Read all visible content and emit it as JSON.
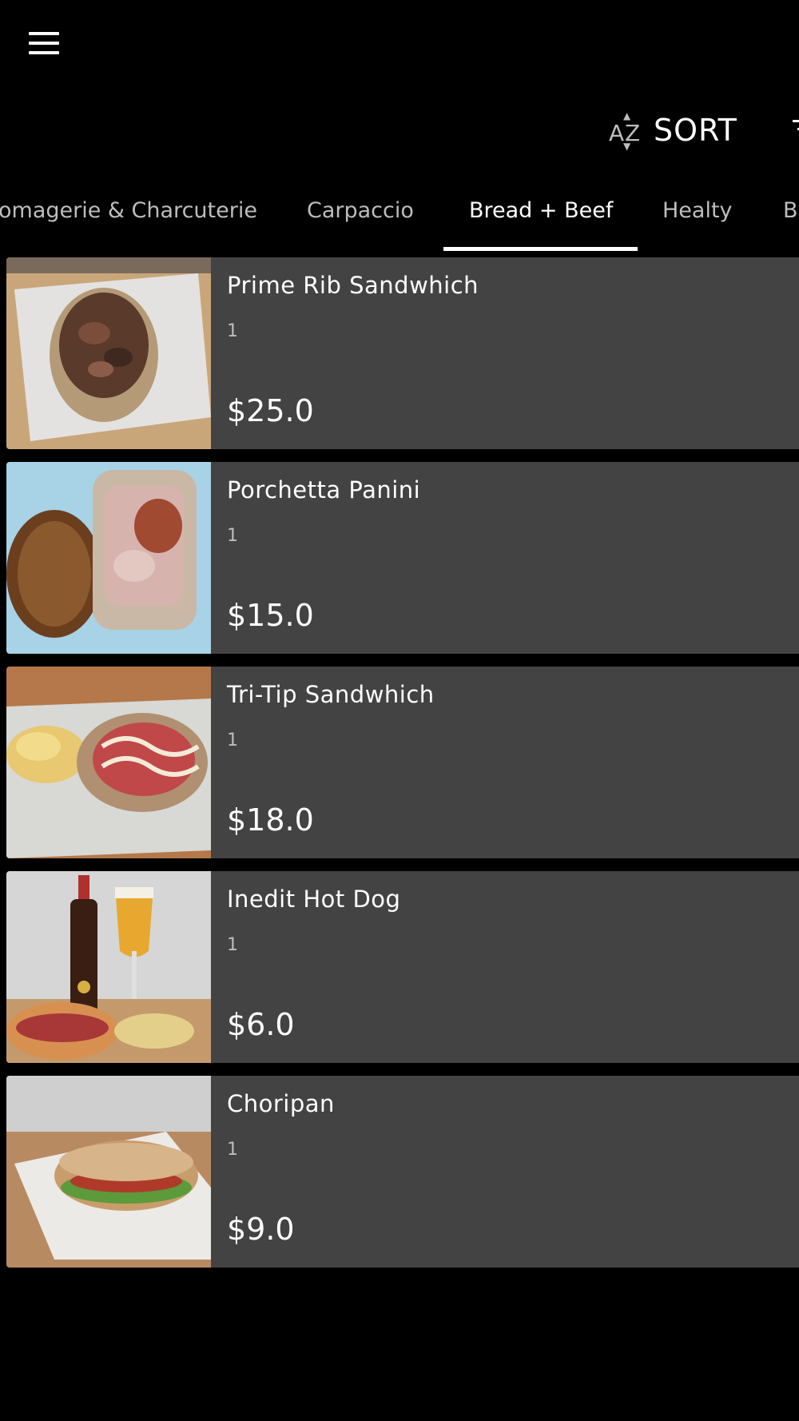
{
  "header": {
    "menu_icon": "hamburger-menu-icon",
    "sort_label": "SORT",
    "sort_icon": "az-sort-icon",
    "sort_icon_text": "AZ",
    "filter_icon": "filter-lines-icon"
  },
  "tabs": [
    {
      "label": "omagerie & Charcuterie",
      "active": false
    },
    {
      "label": "Carpaccio",
      "active": false
    },
    {
      "label": "Bread + Beef",
      "active": true
    },
    {
      "label": "Healty",
      "active": false
    },
    {
      "label": "B",
      "active": false
    }
  ],
  "items": [
    {
      "name": "Prime Rib Sandwhich",
      "qty": "1",
      "price": "$25.0"
    },
    {
      "name": "Porchetta Panini",
      "qty": "1",
      "price": "$15.0"
    },
    {
      "name": "Tri-Tip Sandwhich",
      "qty": "1",
      "price": "$18.0"
    },
    {
      "name": "Inedit Hot Dog",
      "qty": "1",
      "price": "$6.0"
    },
    {
      "name": "Choripan",
      "qty": "1",
      "price": "$9.0"
    }
  ],
  "colors": {
    "background": "#000000",
    "card": "#434343",
    "text": "#ffffff",
    "muted_text": "#bdbdbd"
  }
}
